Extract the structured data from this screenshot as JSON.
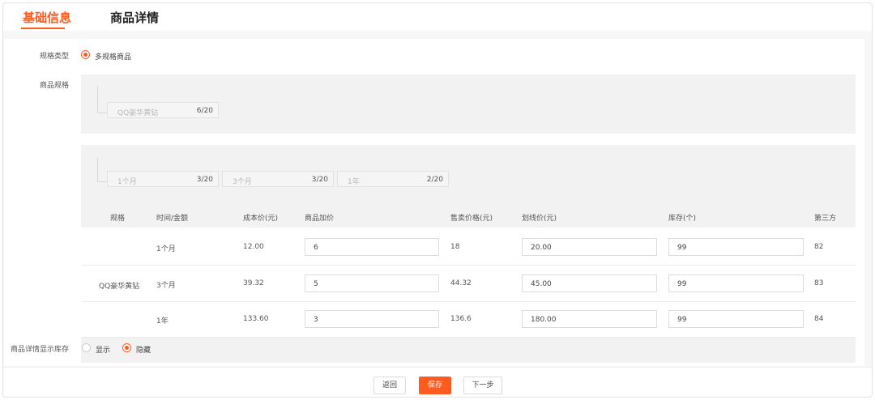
{
  "tabs": [
    {
      "label": "基础信息",
      "active": true
    },
    {
      "label": "商品详情",
      "active": false
    }
  ],
  "spec_type": {
    "label": "规格类型",
    "option": "多规格商品"
  },
  "spec": {
    "label": "商品规格",
    "group1": [
      {
        "value": "QQ豪华黄钻",
        "count": "6/20"
      }
    ],
    "group2": [
      {
        "value": "1个月",
        "count": "3/20"
      },
      {
        "value": "3个月",
        "count": "3/20"
      },
      {
        "value": "1年",
        "count": "2/20"
      }
    ]
  },
  "table": {
    "headers": [
      "规格",
      "时间/金额",
      "成本价(元)",
      "商品加价",
      "售卖价格(元)",
      "划线价(元)",
      "库存(个)",
      "第三方"
    ],
    "spec_name": "QQ豪华黄钻",
    "rows": [
      {
        "time": "1个月",
        "cost": "12.00",
        "markup": "6",
        "sale": "18",
        "strike": "20.00",
        "stock": "99",
        "third": "82"
      },
      {
        "time": "3个月",
        "cost": "39.32",
        "markup": "5",
        "sale": "44.32",
        "strike": "45.00",
        "stock": "99",
        "third": "83"
      },
      {
        "time": "1年",
        "cost": "133.60",
        "markup": "3",
        "sale": "136.6",
        "strike": "180.00",
        "stock": "99",
        "third": "84"
      }
    ]
  },
  "stock_display": {
    "label": "商品详情显示库存",
    "options": [
      {
        "label": "显示",
        "checked": false
      },
      {
        "label": "隐藏",
        "checked": true
      }
    ]
  },
  "footer": {
    "back": "返回",
    "save": "保存",
    "next": "下一步"
  },
  "colors": {
    "accent": "#ff5a1f"
  }
}
